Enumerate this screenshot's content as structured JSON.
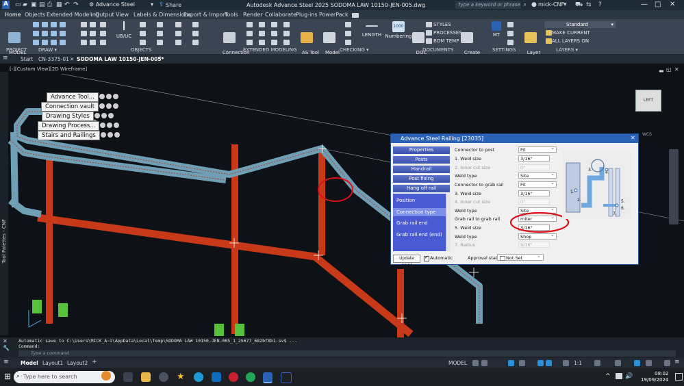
{
  "app": {
    "workspace": "Advance Steel",
    "share": "Share",
    "title": "Autodesk Advance Steel 2025    SODOMA LAW 10150-JEN-005.dwg",
    "search_placeholder": "Type a keyword or phrase",
    "user": "mick-CNF"
  },
  "menu_tabs": [
    "Home",
    "Objects",
    "Extended Modeling",
    "Output",
    "View",
    "Labels & Dimensions",
    "Export & Import",
    "Tools",
    "Render",
    "Collaborate",
    "Plug-ins",
    "PowerPack"
  ],
  "ribbon": {
    "model_browser": "MODEL\nBROWSER",
    "connection_vault": "Connection\nVault",
    "ub_uc": "UB/UC",
    "as_tool_palette": "AS Tool\nPalette",
    "model_check": "Model\nCheck",
    "length": "LENGTH",
    "numbering": "Numbering",
    "doc_man": "DOC\nMAN",
    "styles": "STYLES",
    "processes": "PROCESSES",
    "bom_temp": "BOM TEMP",
    "create_lists": "Create\nLists",
    "mt": "MT",
    "layer_properties": "Layer\nProperties",
    "layer_current": "Standard",
    "make_current": "MAKE CURRENT",
    "all_layers_on": "ALL LAYERS ON",
    "panels": [
      "PROJECT",
      "DRAW ▾",
      "OBJECTS",
      "EXTENDED MODELING",
      "CHECKING ▾",
      "DOCUMENTS",
      "SETTINGS",
      "LAYERS ▾"
    ]
  },
  "file_tabs": [
    "Start",
    "CN-3375-01",
    "SODOMA LAW 10150-JEN-005*"
  ],
  "viewport": {
    "label": "[-][Custom View][2D Wireframe]",
    "viewcube": "LEFT",
    "wcs": "WCS"
  },
  "tool_palette": {
    "label": "Tool Palettes - CNF",
    "items": [
      "Advance Tool...",
      "Connection vault",
      "Drawing Styles",
      "Drawing Process...",
      "Stairs and Railings"
    ]
  },
  "dialog": {
    "title": "Advance Steel   Railing [23035]",
    "nav": [
      "Properties",
      "Posts",
      "Handrail",
      "Post fixing",
      "Hang off rail"
    ],
    "subnav": [
      "Position",
      "Connection type",
      "Grab rail end",
      "Grab rail end (end)"
    ],
    "fields": [
      {
        "label": "Connector to post",
        "value": "Fit",
        "kind": "select",
        "disabled": false
      },
      {
        "label": "1. Weld size",
        "value": "3/16\"",
        "kind": "text",
        "disabled": false
      },
      {
        "label": "2. Inner cut size",
        "value": "0\"",
        "kind": "text",
        "disabled": true
      },
      {
        "label": "Weld type",
        "value": "Site",
        "kind": "select",
        "disabled": false
      },
      {
        "label": "Connector to grab rail",
        "value": "Fit",
        "kind": "select",
        "disabled": false
      },
      {
        "label": "3. Weld size",
        "value": "3/16\"",
        "kind": "text",
        "disabled": false
      },
      {
        "label": "4. Inner cut size",
        "value": "0\"",
        "kind": "text",
        "disabled": true
      },
      {
        "label": "Weld type",
        "value": "Site",
        "kind": "select",
        "disabled": false
      },
      {
        "label": "Grab rail to grab rail",
        "value": "miter",
        "kind": "select",
        "disabled": false
      },
      {
        "label": "5. Weld size",
        "value": "3/16\"",
        "kind": "text",
        "disabled": false
      },
      {
        "label": "Weld type",
        "value": "Shop",
        "kind": "select",
        "disabled": false
      },
      {
        "label": "7. Radius",
        "value": "9/16\"",
        "kind": "text",
        "disabled": true
      }
    ],
    "diagram_labels": [
      "1.",
      "2.",
      "3.",
      "4.",
      "5.",
      "6.",
      "7."
    ],
    "update_now": "Update now!",
    "automatic": "Automatic",
    "approval_status_label": "Approval status",
    "approval_status_value": "Not Set"
  },
  "command": {
    "history": "Automatic save to C:\\Users\\MICK_A~1\\AppData\\Local\\Temp\\SODOMA LAW 10150-JEN-005_1_25677_682bf8b1.sv$ ...\nCommand:",
    "placeholder": "Type a command"
  },
  "layout_tabs": [
    "Model",
    "Layout1",
    "Layout2"
  ],
  "status": {
    "model": "MODEL",
    "scale": "1:1"
  },
  "taskbar": {
    "search_placeholder": "Type here to search",
    "time": "08:02",
    "date": "19/09/2024"
  },
  "colors": {
    "accent": "#2a63b6",
    "rail_red": "#d2401f",
    "rail_blue": "#6f9fb4",
    "annotation": "#e0101a"
  }
}
